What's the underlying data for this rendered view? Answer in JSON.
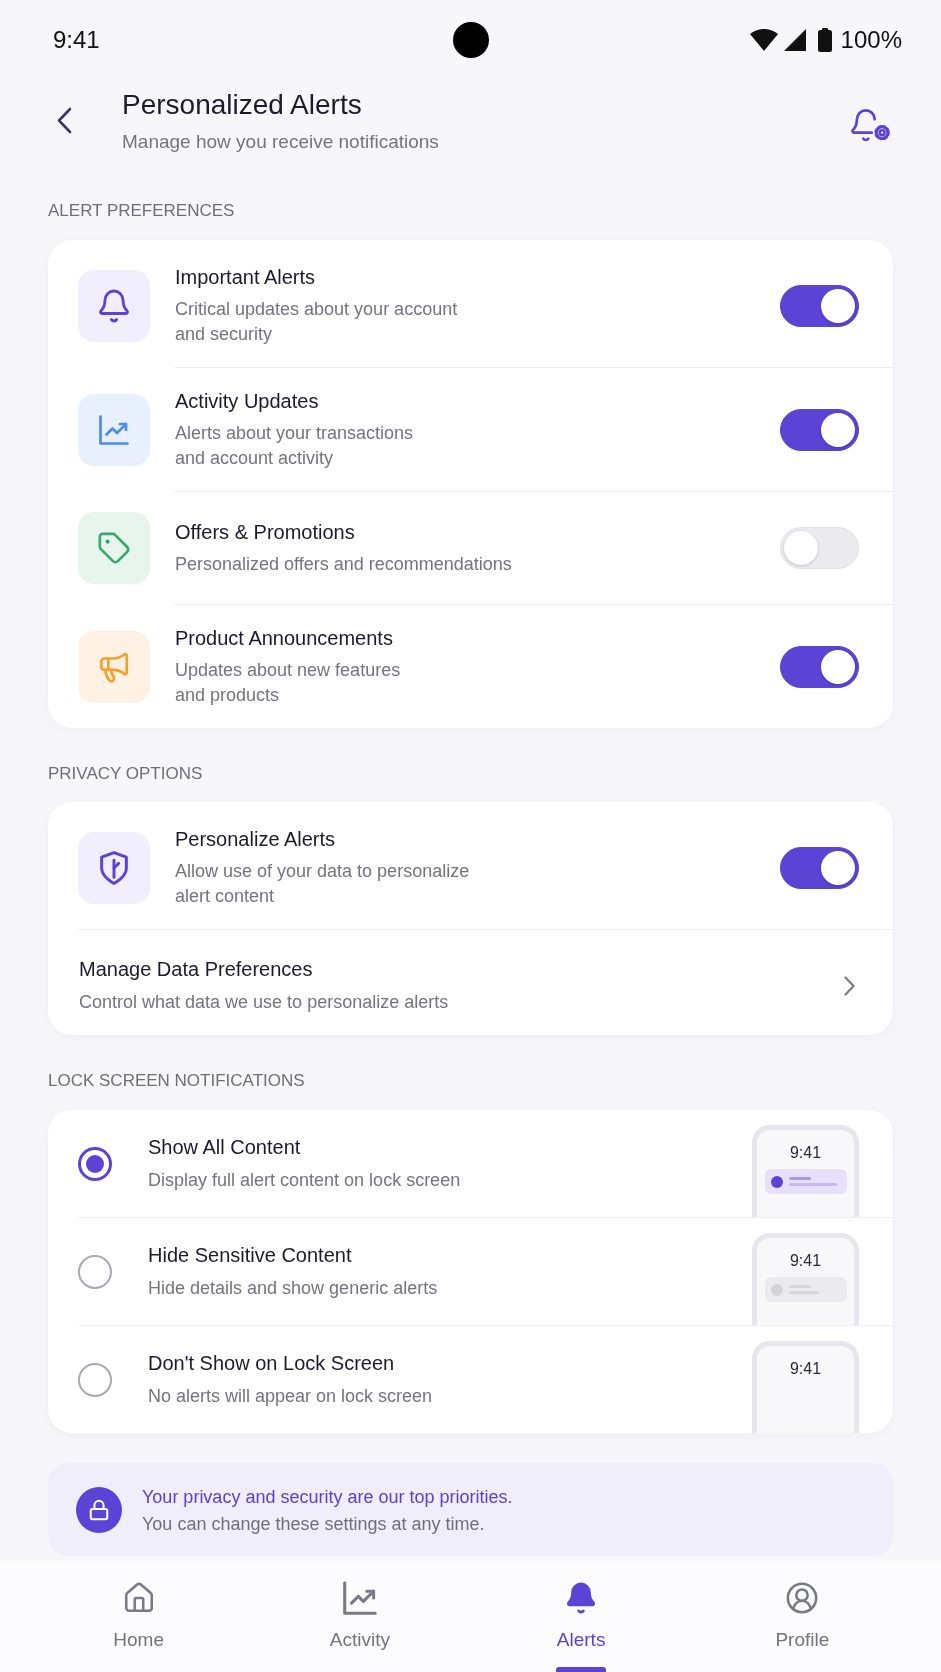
{
  "status_bar": {
    "time": "9:41",
    "battery": "100%"
  },
  "header": {
    "title": "Personalized Alerts",
    "subtitle": "Manage how you receive notifications"
  },
  "alert_preferences": {
    "heading": "ALERT PREFERENCES",
    "items": [
      {
        "title": "Important Alerts",
        "description": "Critical updates about your account\nand security",
        "on": true
      },
      {
        "title": "Activity Updates",
        "description": "Alerts about your transactions\nand account activity",
        "on": true
      },
      {
        "title": "Offers & Promotions",
        "description": "Personalized offers and recommendations",
        "on": false
      },
      {
        "title": "Product Announcements",
        "description": "Updates about new features\nand products",
        "on": true
      }
    ]
  },
  "privacy_options": {
    "heading": "PRIVACY OPTIONS",
    "items": [
      {
        "kind": "toggle",
        "title": "Personalize Alerts",
        "description": "Allow use of your data to personalize\nalert content",
        "on": true
      },
      {
        "kind": "link",
        "title": "Manage Data Preferences",
        "description": "Control what data we use to personalize alerts"
      }
    ]
  },
  "lock_screen": {
    "heading": "LOCK SCREEN NOTIFICATIONS",
    "options": [
      {
        "kind": "full",
        "title": "Show All Content",
        "description": "Display full alert content on lock screen",
        "selected": true,
        "preview_time": "9:41"
      },
      {
        "kind": "generic",
        "title": "Hide Sensitive Content",
        "description": "Hide details and show generic alerts",
        "selected": false,
        "preview_time": "9:41"
      },
      {
        "kind": "none",
        "title": "Don't Show on Lock Screen",
        "description": "No alerts will appear on lock screen",
        "selected": false,
        "preview_time": "9:41"
      }
    ]
  },
  "info_banner": {
    "title": "Your privacy and security are our top priorities.",
    "text": "You can change these settings at any time."
  },
  "bottom_nav": {
    "items": [
      {
        "label": "Home",
        "selected": false
      },
      {
        "label": "Activity",
        "selected": false
      },
      {
        "label": "Alerts",
        "selected": true
      },
      {
        "label": "Profile",
        "selected": false
      }
    ]
  }
}
